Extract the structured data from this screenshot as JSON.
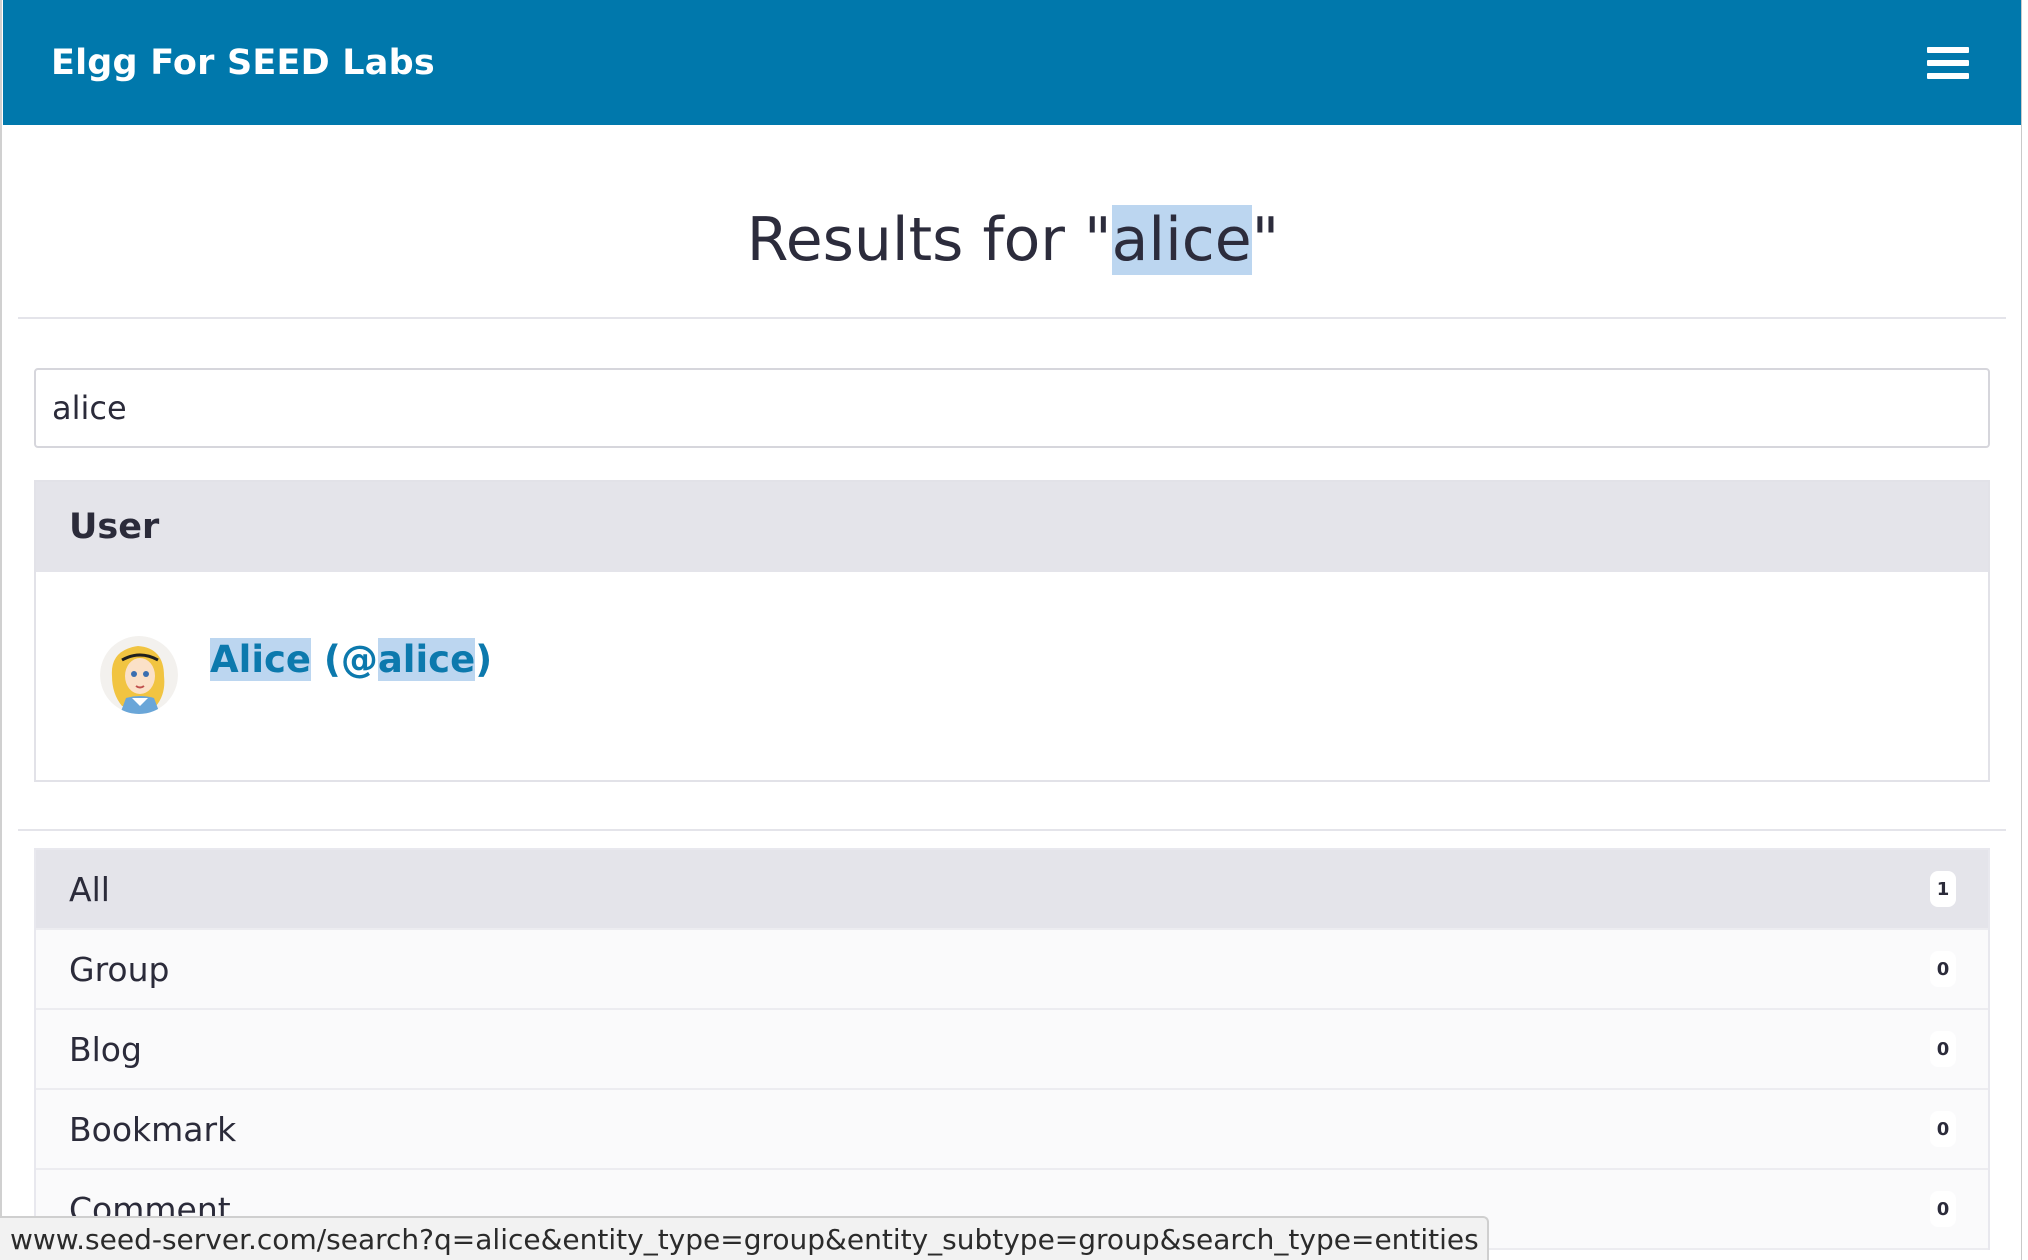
{
  "header": {
    "brand": "Elgg For SEED Labs",
    "menu_icon": "hamburger-menu-icon",
    "background_color": "#0078ac"
  },
  "page": {
    "title_prefix": "Results for \"",
    "title_query": "alice",
    "title_suffix": "\""
  },
  "search": {
    "value": "alice"
  },
  "results_panel": {
    "heading": "User",
    "items": [
      {
        "avatar_icon": "alice-avatar-icon",
        "name": "Alice",
        "handle_open": " (@",
        "handle": "alice",
        "handle_close": ")"
      }
    ]
  },
  "filter_menu": {
    "items": [
      {
        "label": "All",
        "count": "1",
        "active": true
      },
      {
        "label": "Group",
        "count": "0",
        "active": false
      },
      {
        "label": "Blog",
        "count": "0",
        "active": false
      },
      {
        "label": "Bookmark",
        "count": "0",
        "active": false
      },
      {
        "label": "Comment",
        "count": "0",
        "active": false
      }
    ]
  },
  "status_bar": {
    "url": "www.seed-server.com/search?q=alice&entity_type=group&entity_subtype=group&search_type=entities"
  },
  "colors": {
    "link": "#0c79ad",
    "highlight": "#bcd6f0",
    "panel_header": "#e4e4ea"
  }
}
